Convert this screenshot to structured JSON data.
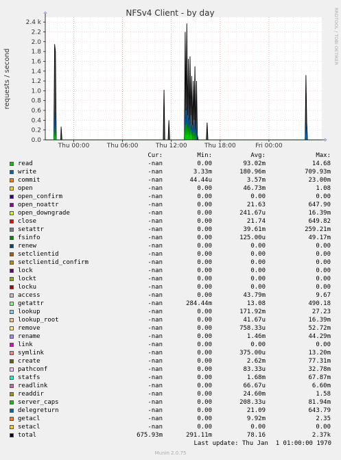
{
  "chart_data": {
    "type": "area",
    "title": "NFSv4 Client - by day",
    "ylabel": "requests / second",
    "side_label": "RRDTOOL / TOBI OETIKER",
    "x_ticks": [
      "Thu 00:00",
      "Thu 06:00",
      "Thu 12:00",
      "Thu 18:00",
      "Fri 00:00"
    ],
    "x_range_hours": [
      -3.5,
      30.5
    ],
    "y_ticks": [
      "0.0",
      "0.2",
      "0.4",
      "0.6",
      "0.8",
      "1.0",
      "1.2",
      "1.4",
      "1.6",
      "1.8",
      "2.0",
      "2.2",
      "2.4 k"
    ],
    "ylim": [
      0,
      2.5
    ],
    "y_unit": "k",
    "grid": true,
    "total_series": [
      [
        -3.5,
        0
      ],
      [
        -2.45,
        0
      ],
      [
        -2.35,
        1.95
      ],
      [
        -2.25,
        1.8
      ],
      [
        -2.15,
        0
      ],
      [
        -1.6,
        0
      ],
      [
        -1.55,
        0.27
      ],
      [
        -1.45,
        0
      ],
      [
        11.0,
        0
      ],
      [
        11.1,
        1.02
      ],
      [
        11.2,
        0
      ],
      [
        11.6,
        0
      ],
      [
        11.7,
        0.4
      ],
      [
        11.8,
        0
      ],
      [
        13.6,
        0
      ],
      [
        13.7,
        2.2
      ],
      [
        13.8,
        0.6
      ],
      [
        13.9,
        2.37
      ],
      [
        14.0,
        0.5
      ],
      [
        14.1,
        1.65
      ],
      [
        14.2,
        0.4
      ],
      [
        14.3,
        1.7
      ],
      [
        14.4,
        0.5
      ],
      [
        14.5,
        1.3
      ],
      [
        14.6,
        0.3
      ],
      [
        14.7,
        1.2
      ],
      [
        14.8,
        0.4
      ],
      [
        14.9,
        1.5
      ],
      [
        15.0,
        0.2
      ],
      [
        15.1,
        1.2
      ],
      [
        15.2,
        0.1
      ],
      [
        15.3,
        0
      ],
      [
        16.3,
        0
      ],
      [
        16.4,
        0.35
      ],
      [
        16.5,
        0
      ],
      [
        28.45,
        0
      ],
      [
        28.55,
        1.32
      ],
      [
        28.65,
        0.35
      ],
      [
        28.75,
        0
      ],
      [
        30.5,
        0
      ]
    ],
    "blue_series": [
      [
        -3.5,
        0
      ],
      [
        -2.45,
        0
      ],
      [
        -2.35,
        0.58
      ],
      [
        -2.25,
        0.4
      ],
      [
        -2.15,
        0
      ],
      [
        13.6,
        0
      ],
      [
        13.7,
        0.62
      ],
      [
        13.8,
        0.3
      ],
      [
        13.9,
        0.66
      ],
      [
        14.0,
        0.2
      ],
      [
        14.1,
        0.45
      ],
      [
        14.2,
        0.15
      ],
      [
        14.3,
        0.5
      ],
      [
        14.4,
        0.2
      ],
      [
        14.5,
        0.3
      ],
      [
        14.6,
        0.1
      ],
      [
        14.7,
        0.35
      ],
      [
        14.8,
        0.15
      ],
      [
        14.9,
        0.4
      ],
      [
        15.0,
        0.1
      ],
      [
        15.1,
        0.2
      ],
      [
        15.2,
        0
      ],
      [
        28.45,
        0
      ],
      [
        28.55,
        0.35
      ],
      [
        28.65,
        0.15
      ],
      [
        28.75,
        0
      ],
      [
        30.5,
        0
      ]
    ],
    "green_series": [
      [
        -3.5,
        0
      ],
      [
        -2.45,
        0
      ],
      [
        -2.35,
        0.25
      ],
      [
        -2.25,
        0.1
      ],
      [
        -2.15,
        0
      ],
      [
        13.6,
        0
      ],
      [
        13.7,
        0.3
      ],
      [
        13.8,
        0.1
      ],
      [
        13.9,
        0.35
      ],
      [
        14.0,
        0.1
      ],
      [
        14.1,
        0.25
      ],
      [
        14.2,
        0.05
      ],
      [
        14.3,
        0.3
      ],
      [
        14.4,
        0.1
      ],
      [
        14.5,
        0.2
      ],
      [
        14.6,
        0
      ],
      [
        14.7,
        0.2
      ],
      [
        14.8,
        0
      ],
      [
        14.9,
        0.15
      ],
      [
        15.0,
        0
      ],
      [
        30.5,
        0
      ]
    ]
  },
  "legend": {
    "headers": {
      "cur": "Cur:",
      "min": "Min:",
      "avg": "Avg:",
      "max": "Max:"
    },
    "rows": [
      {
        "name": "read",
        "color": "#00cc00",
        "cur": "-nan",
        "min": "0.00",
        "avg": "93.02m",
        "max": "14.68"
      },
      {
        "name": "write",
        "color": "#0066b3",
        "cur": "-nan",
        "min": "3.33m",
        "avg": "180.96m",
        "max": "709.93m"
      },
      {
        "name": "commit",
        "color": "#ff8000",
        "cur": "-nan",
        "min": "44.44u",
        "avg": "3.57m",
        "max": "23.00m"
      },
      {
        "name": "open",
        "color": "#ffcc00",
        "cur": "-nan",
        "min": "0.00",
        "avg": "46.73m",
        "max": "1.08"
      },
      {
        "name": "open_confirm",
        "color": "#330099",
        "cur": "-nan",
        "min": "0.00",
        "avg": "0.00",
        "max": "0.00"
      },
      {
        "name": "open_noattr",
        "color": "#990099",
        "cur": "-nan",
        "min": "0.00",
        "avg": "21.63",
        "max": "647.90"
      },
      {
        "name": "open_downgrade",
        "color": "#ccff00",
        "cur": "-nan",
        "min": "0.00",
        "avg": "241.67u",
        "max": "16.39m"
      },
      {
        "name": "close",
        "color": "#ff0000",
        "cur": "-nan",
        "min": "0.00",
        "avg": "21.74",
        "max": "649.82"
      },
      {
        "name": "setattr",
        "color": "#808080",
        "cur": "-nan",
        "min": "0.00",
        "avg": "39.61m",
        "max": "259.21m"
      },
      {
        "name": "fsinfo",
        "color": "#008f00",
        "cur": "-nan",
        "min": "0.00",
        "avg": "125.00u",
        "max": "49.17m"
      },
      {
        "name": "renew",
        "color": "#00487d",
        "cur": "-nan",
        "min": "0.00",
        "avg": "0.00",
        "max": "0.00"
      },
      {
        "name": "setclientid",
        "color": "#b35a00",
        "cur": "-nan",
        "min": "0.00",
        "avg": "0.00",
        "max": "0.00"
      },
      {
        "name": "setclientid_confirm",
        "color": "#b38f00",
        "cur": "-nan",
        "min": "0.00",
        "avg": "0.00",
        "max": "0.00"
      },
      {
        "name": "lock",
        "color": "#6b006b",
        "cur": "-nan",
        "min": "0.00",
        "avg": "0.00",
        "max": "0.00"
      },
      {
        "name": "lockt",
        "color": "#8fb300",
        "cur": "-nan",
        "min": "0.00",
        "avg": "0.00",
        "max": "0.00"
      },
      {
        "name": "locku",
        "color": "#b30000",
        "cur": "-nan",
        "min": "0.00",
        "avg": "0.00",
        "max": "0.00"
      },
      {
        "name": "access",
        "color": "#bebebe",
        "cur": "-nan",
        "min": "0.00",
        "avg": "43.79m",
        "max": "9.67"
      },
      {
        "name": "getattr",
        "color": "#80ff80",
        "cur": "-nan",
        "min": "284.44m",
        "avg": "13.08",
        "max": "490.18"
      },
      {
        "name": "lookup",
        "color": "#80c9ff",
        "cur": "-nan",
        "min": "0.00",
        "avg": "171.92m",
        "max": "27.23"
      },
      {
        "name": "lookup_root",
        "color": "#ffc080",
        "cur": "-nan",
        "min": "0.00",
        "avg": "41.67u",
        "max": "16.39m"
      },
      {
        "name": "remove",
        "color": "#ffe680",
        "cur": "-nan",
        "min": "0.00",
        "avg": "758.33u",
        "max": "52.72m"
      },
      {
        "name": "rename",
        "color": "#aa80ff",
        "cur": "-nan",
        "min": "0.00",
        "avg": "1.46m",
        "max": "44.29m"
      },
      {
        "name": "link",
        "color": "#ee00cc",
        "cur": "-nan",
        "min": "0.00",
        "avg": "0.00",
        "max": "0.00"
      },
      {
        "name": "symlink",
        "color": "#ff8080",
        "cur": "-nan",
        "min": "0.00",
        "avg": "375.00u",
        "max": "13.20m"
      },
      {
        "name": "create",
        "color": "#666600",
        "cur": "-nan",
        "min": "0.00",
        "avg": "2.62m",
        "max": "77.31m"
      },
      {
        "name": "pathconf",
        "color": "#ffbfff",
        "cur": "-nan",
        "min": "0.00",
        "avg": "83.33u",
        "max": "32.78m"
      },
      {
        "name": "statfs",
        "color": "#00ffcc",
        "cur": "-nan",
        "min": "0.00",
        "avg": "1.68m",
        "max": "67.87m"
      },
      {
        "name": "readlink",
        "color": "#cc6699",
        "cur": "-nan",
        "min": "0.00",
        "avg": "66.67u",
        "max": "6.60m"
      },
      {
        "name": "readdir",
        "color": "#999900",
        "cur": "-nan",
        "min": "0.00",
        "avg": "24.60m",
        "max": "1.58"
      },
      {
        "name": "server_caps",
        "color": "#00cc00",
        "cur": "-nan",
        "min": "0.00",
        "avg": "208.33u",
        "max": "81.94m"
      },
      {
        "name": "delegreturn",
        "color": "#0066b3",
        "cur": "-nan",
        "min": "0.00",
        "avg": "21.09",
        "max": "643.79"
      },
      {
        "name": "getacl",
        "color": "#ff8000",
        "cur": "-nan",
        "min": "0.00",
        "avg": "9.92m",
        "max": "2.35"
      },
      {
        "name": "setacl",
        "color": "#ffcc00",
        "cur": "-nan",
        "min": "0.00",
        "avg": "0.00",
        "max": "0.00"
      },
      {
        "name": "total",
        "color": "#000000",
        "cur": "675.93m",
        "min": "291.11m",
        "avg": "78.16",
        "max": "2.37k"
      }
    ]
  },
  "last_update": "Last update: Thu Jan  1 01:00:00 1970",
  "footer": "Munin 2.0.75"
}
